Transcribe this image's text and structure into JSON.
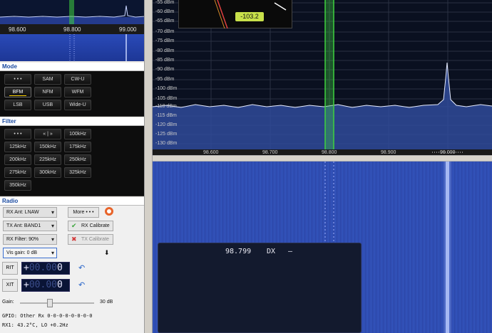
{
  "mini_axis": {
    "ticks": [
      "98.600",
      "98.800",
      "99.000"
    ]
  },
  "mode": {
    "title": "Mode",
    "buttons": [
      "• • •",
      "SAM",
      "CW-U",
      "BFM",
      "NFM",
      "WFM",
      "LSB",
      "USB",
      "Wide-U"
    ],
    "active": "BFM"
  },
  "filter": {
    "title": "Filter",
    "buttons": [
      "• • •",
      "« | »",
      "100kHz",
      "125kHz",
      "150kHz",
      "175kHz",
      "200kHz",
      "225kHz",
      "250kHz",
      "275kHz",
      "300kHz",
      "325kHz",
      "350kHz"
    ]
  },
  "radio": {
    "title": "Radio",
    "rx_ant": "RX Ant: LNAW",
    "tx_ant": "TX Ant: BAND1",
    "rx_filter": "RX Filter: 90%",
    "vis_gain": "Vis gain: 0 dB",
    "more_label": "More  • • •",
    "rx_calibrate": "RX Calibrate",
    "tx_calibrate": "TX Calibrate",
    "rit_label": "RIT",
    "xit_label": "XIT",
    "rit_value": "+00.000",
    "xit_value": "+00.000",
    "gain_label": "Gain:",
    "gain_value": "30 dB",
    "gpio_line": "GPIO: Other Rx 0-0-0-0-0-0-0-0",
    "rx1_line": "RX1:   43.2°C, LO +0.2Hz"
  },
  "spectrum": {
    "dbm_labels": [
      "-55 dBm",
      "-60 dBm",
      "-65 dBm",
      "-70 dBm",
      "-75 dBm",
      "-80 dBm",
      "-85 dBm",
      "-90 dBm",
      "-95 dBm",
      "-100 dBm",
      "-105 dBm",
      "-110 dBm",
      "-115 dBm",
      "-120 dBm",
      "-125 dBm",
      "-130 dBm"
    ],
    "freq_labels": [
      "98.600",
      "98.700",
      "98.800",
      "98.900",
      "99.000"
    ],
    "s_meter_value": "-103.2",
    "accent_color": "#3fd23f"
  },
  "overlay": {
    "freq": "98.799",
    "mode": "DX",
    "dash": "–"
  }
}
